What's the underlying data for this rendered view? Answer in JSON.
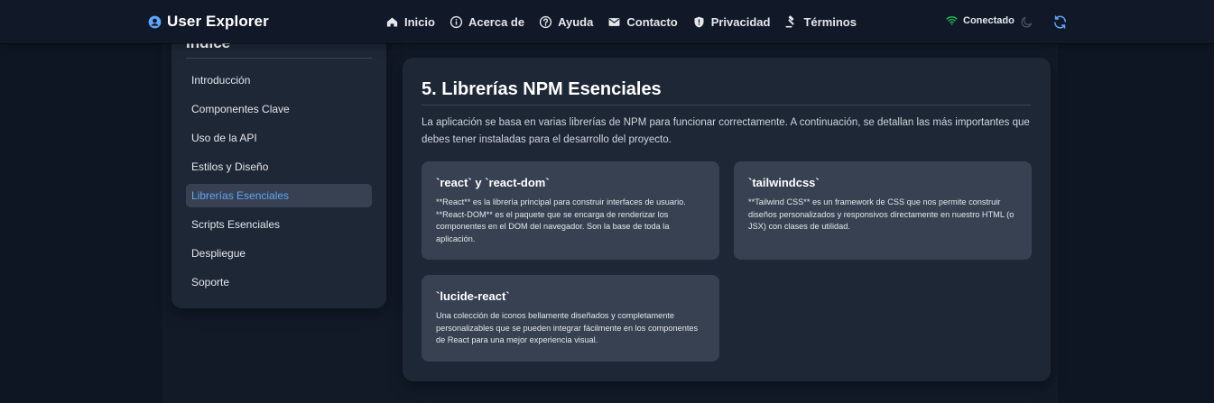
{
  "header": {
    "brand_title": "User Explorer",
    "nav": [
      {
        "label": "Inicio",
        "icon": "home-icon"
      },
      {
        "label": "Acerca de",
        "icon": "info-icon"
      },
      {
        "label": "Ayuda",
        "icon": "help-icon"
      },
      {
        "label": "Contacto",
        "icon": "mail-icon"
      },
      {
        "label": "Privacidad",
        "icon": "shield-icon"
      },
      {
        "label": "Términos",
        "icon": "gavel-icon"
      }
    ],
    "status_text": "Conectado",
    "status_color": "#22c55e",
    "accent_color": "#60a5fa"
  },
  "sidebar": {
    "title": "Índice",
    "items": [
      {
        "label": "Introducción"
      },
      {
        "label": "Componentes Clave"
      },
      {
        "label": "Uso de la API"
      },
      {
        "label": "Estilos y Diseño"
      },
      {
        "label": "Librerías Esenciales",
        "active": true
      },
      {
        "label": "Scripts Esenciales"
      },
      {
        "label": "Despliegue"
      },
      {
        "label": "Soporte"
      }
    ]
  },
  "main": {
    "title": "5. Librerías NPM Esenciales",
    "intro": "La aplicación se basa en varias librerías de NPM para funcionar correctamente. A continuación, se detallan las más importantes que debes tener instaladas para el desarrollo del proyecto.",
    "cards": [
      {
        "title": "`react` y `react-dom`",
        "body": "**React** es la librería principal para construir interfaces de usuario. **React-DOM** es el paquete que se encarga de renderizar los componentes en el DOM del navegador. Son la base de toda la aplicación."
      },
      {
        "title": "`tailwindcss`",
        "body": "**Tailwind CSS** es un framework de CSS que nos permite construir diseños personalizados y responsivos directamente en nuestro HTML (o JSX) con clases de utilidad."
      },
      {
        "title": "`lucide-react`",
        "body": "Una colección de iconos bellamente diseñados y completamente personalizables que se pueden integrar fácilmente en los componentes de React para una mejor experiencia visual."
      }
    ]
  }
}
